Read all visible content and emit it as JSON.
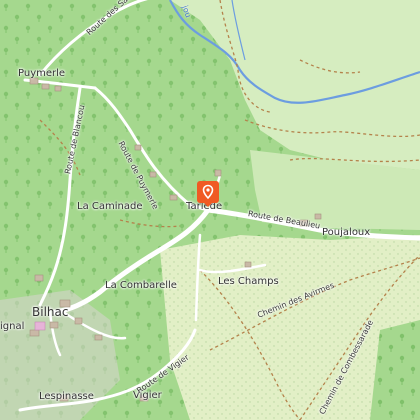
{
  "map": {
    "places": {
      "puymerle": "Puymerle",
      "la_caminade": "La Caminade",
      "taillede": "Tarlède",
      "poujaloux": "Poujaloux",
      "les_champs": "Les Champs",
      "la_combarelle": "La Combarelle",
      "bilhac": "Bilhac",
      "signal": "ignal",
      "lespinasse": "Lespinasse",
      "vigier": "Vigier"
    },
    "roads": {
      "route_sau": "Route des Sau",
      "route_blancou": "Route de Blancou",
      "route_puymerle": "Route de Puymerle",
      "route_beaulieu": "Route de Beaulieu",
      "chemin_avirmes": "Chemin des Avirmes",
      "chemin_combessarade": "Chemin de Combessarade",
      "route_vigier": "Route de Vigier"
    },
    "water": {
      "river_label": "jou"
    },
    "marker": {
      "icon": "map-pin-icon",
      "color": "#f05a24"
    },
    "colors": {
      "forest": "#a5d88e",
      "meadow": "#d6edc0",
      "field": "#e2efc6",
      "water": "#6c9de0",
      "road": "#ffffff",
      "path": "#b4824b"
    }
  }
}
